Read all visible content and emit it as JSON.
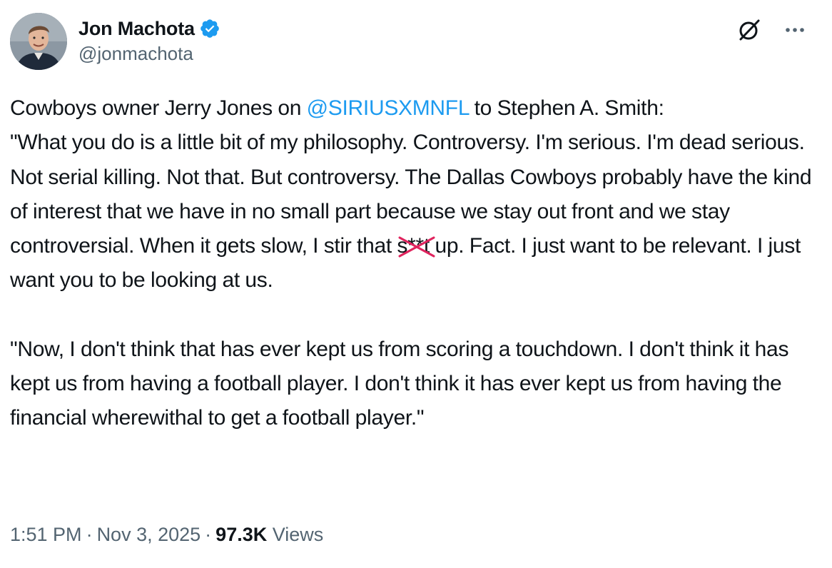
{
  "author": {
    "display_name": "Jon Machota",
    "handle": "@jonmachota",
    "verified": true
  },
  "tweet": {
    "intro_before_mention": "Cowboys owner Jerry Jones on ",
    "mention": "@SIRIUSXMNFL",
    "intro_after_mention": " to Stephen A. Smith:",
    "quote1_part1": "\"What you do is a little bit of my philosophy. Controversy. I'm serious. I'm dead serious. Not serial killing. Not that. But controversy. The Dallas Cowboys probably have the kind of interest that we have in no small part because we stay out front and we stay controversial. When it gets slow, I stir that ",
    "censored_word": "s**t",
    "quote1_part2": " up. Fact. I just want to be relevant. I just want you to be looking at us.",
    "quote2": "\"Now, I don't think that has ever kept us from scoring a touchdown. I don't think it has kept us from having a football player. I don't think it has ever kept us from having the financial wherewithal to get a football player.\""
  },
  "meta": {
    "time": "1:51 PM",
    "separator": "·",
    "date": "Nov 3, 2025",
    "views_count": "97.3K",
    "views_label": "Views"
  },
  "icons": {
    "verified": "verified-badge-icon",
    "grok": "grok-icon",
    "more": "more-options-icon"
  },
  "colors": {
    "text": "#0f1419",
    "secondary": "#536471",
    "accent": "#1d9bf0",
    "censor_mark": "#e0245e"
  }
}
